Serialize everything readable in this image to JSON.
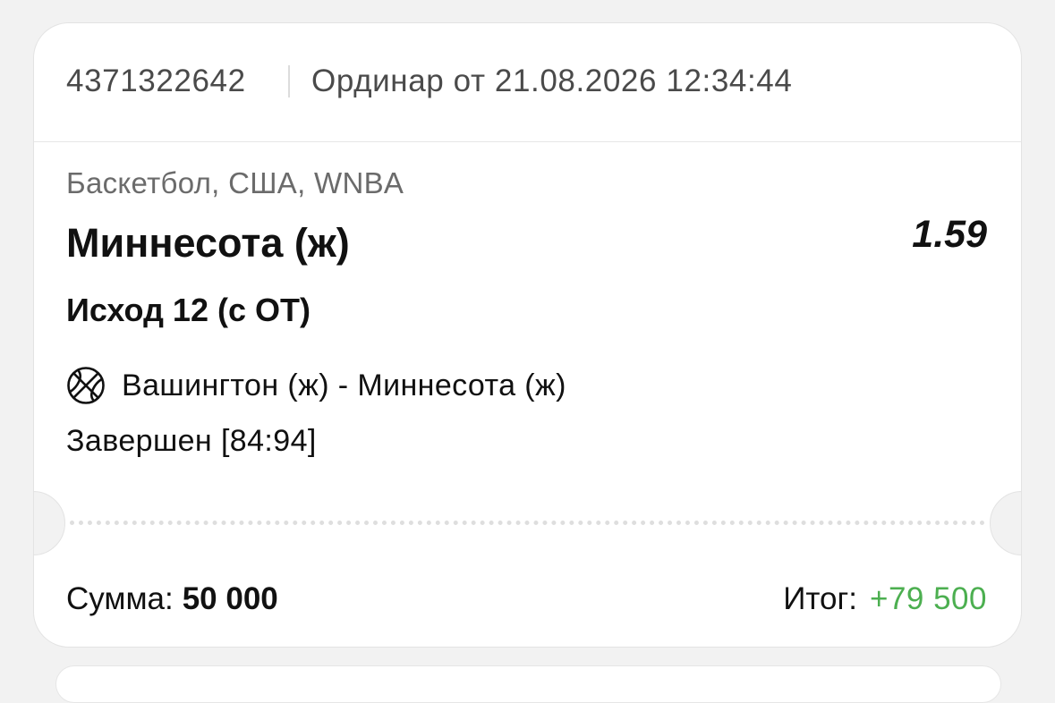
{
  "ticket": {
    "id": "4371322642",
    "bet_type": "Ординар от 21.08.2026 12:34:44",
    "category": "Баскетбол, США, WNBA",
    "pick": "Миннесота (ж)",
    "odds": "1.59",
    "outcome": "Исход 12 (с ОТ)",
    "sport_icon": "basketball-icon",
    "match": "Вашингтон (ж) - Миннесота (ж)",
    "status": "Завершен [84:94]"
  },
  "footer": {
    "sum_label": "Сумма:",
    "sum_value": "50 000",
    "total_label": "Итог:",
    "total_value": "+79 500"
  },
  "colors": {
    "win": "#4caf50",
    "background": "#f2f2f2"
  }
}
